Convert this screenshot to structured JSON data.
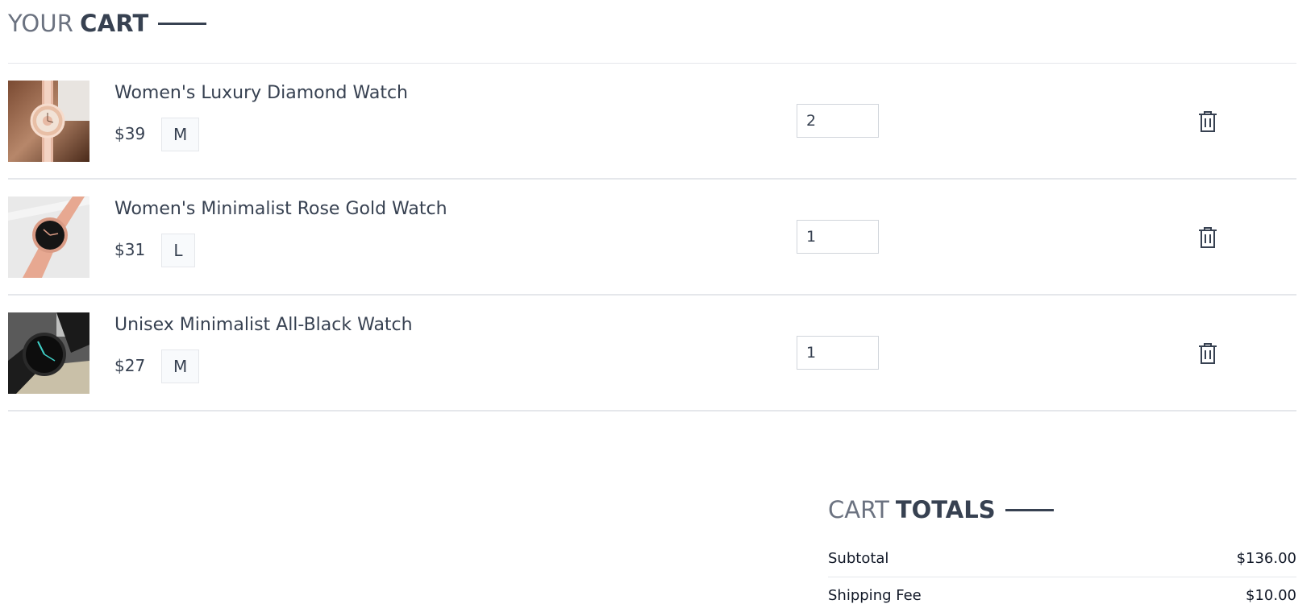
{
  "cart_title": {
    "light": "YOUR",
    "bold": "CART"
  },
  "items": [
    {
      "name": "Women's Luxury Diamond Watch",
      "price": "$39",
      "size": "M",
      "quantity": "2",
      "image": "watch-rose-gold-diamond"
    },
    {
      "name": "Women's Minimalist Rose Gold Watch",
      "price": "$31",
      "size": "L",
      "quantity": "1",
      "image": "watch-rose-gold-mesh"
    },
    {
      "name": "Unisex Minimalist All-Black Watch",
      "price": "$27",
      "size": "M",
      "quantity": "1",
      "image": "watch-all-black"
    }
  ],
  "totals": {
    "title": {
      "light": "CART",
      "bold": "TOTALS"
    },
    "rows": [
      {
        "label": "Subtotal",
        "value": "$136.00"
      },
      {
        "label": "Shipping Fee",
        "value": "$10.00"
      }
    ]
  },
  "icons": {
    "delete": "trash-icon"
  },
  "colors": {
    "text": "#374151",
    "muted": "#6b7280",
    "border": "#e5e7eb"
  }
}
